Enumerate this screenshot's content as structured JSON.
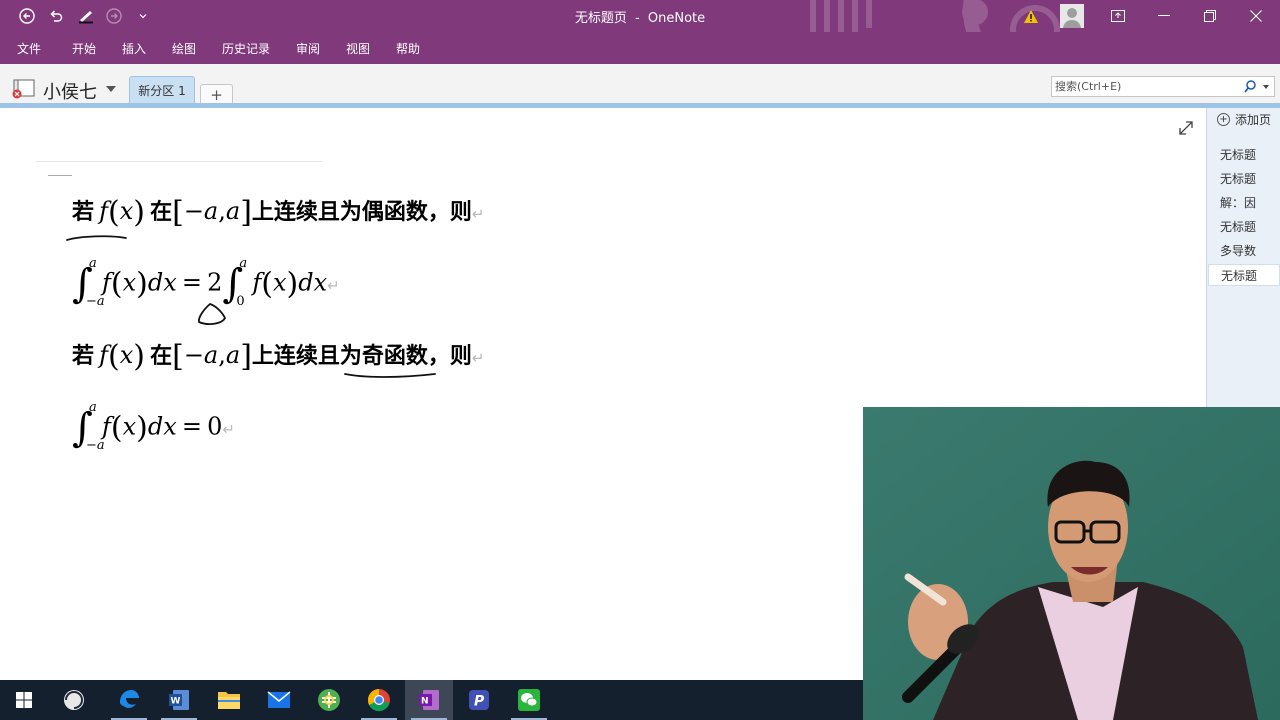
{
  "window": {
    "doc_title": "无标题页",
    "separator": "-",
    "app_name": "OneNote"
  },
  "menu": [
    "文件",
    "开始",
    "插入",
    "绘图",
    "历史记录",
    "审阅",
    "视图",
    "帮助"
  ],
  "notebook": {
    "name": "小侯七",
    "section_tab": "新分区 1",
    "add_tab": "+"
  },
  "search": {
    "placeholder": "搜索(Ctrl+E)"
  },
  "pages_panel": {
    "add_label": "添加页",
    "items": [
      "无标题",
      "无标题",
      "解：因",
      "无标题",
      "多导数",
      "无标题"
    ],
    "selected_index": 5
  },
  "content": {
    "line1": {
      "ruo": "若",
      "zai": "在",
      "neg_a": "−a",
      "comma": ",",
      "a": "a",
      "tail": "上连续且为偶函数，则"
    },
    "line2": {
      "upper": "a",
      "lower": "−a",
      "eq": "=",
      "coef": "2",
      "upper2": "a",
      "lower2": "0",
      "dx": "dx"
    },
    "line3": {
      "ruo": "若",
      "zai": "在",
      "neg_a": "−a",
      "comma": ",",
      "a": "a",
      "tail": "上连续且为奇函数，则"
    },
    "line4": {
      "upper": "a",
      "lower": "−a",
      "eq": "=",
      "rhs": "0",
      "dx": "dx"
    },
    "f": "f",
    "x": "x",
    "return_mark": "↵"
  },
  "taskbar": {
    "apps": [
      "windows-start",
      "task-view",
      "edge",
      "word",
      "file-explorer",
      "mail",
      "360-browser",
      "chrome",
      "onenote",
      "powerpoint-like",
      "wechat"
    ],
    "active": "onenote"
  },
  "colors": {
    "ribbon": "#80397b",
    "notebook_bar": "#f3f3f3",
    "section_tab": "#c9dff2",
    "pages_panel": "#e9f0f8",
    "taskbar": "#15202e"
  }
}
